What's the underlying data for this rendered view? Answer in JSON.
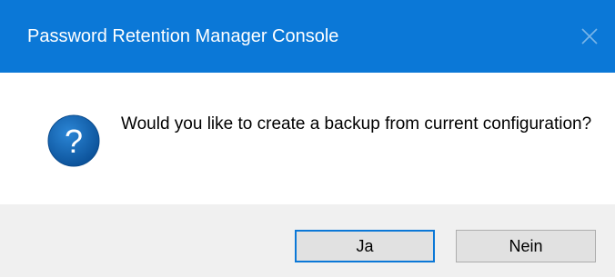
{
  "window": {
    "title": "Password Retention Manager Console",
    "close_icon": "close-icon",
    "titlebar_color": "#0b78d7"
  },
  "message": {
    "icon": "question-icon",
    "text": "Would you like to create a backup from current configuration?"
  },
  "buttons": {
    "yes_label": "Ja",
    "no_label": "Nein"
  }
}
